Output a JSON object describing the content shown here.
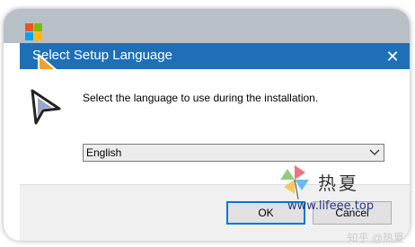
{
  "window": {
    "title": "Select Setup Language",
    "close_glyph": "✕",
    "message": "Select the language to use during the installation.",
    "language_select": {
      "selected": "English"
    },
    "buttons": {
      "ok": "OK",
      "cancel": "Cancel"
    }
  },
  "watermark": {
    "brand": "热夏",
    "site": "www.lifeee.top"
  },
  "credit": "知乎 @热夏",
  "colors": {
    "titlebar": "#1f6fb7",
    "ok_focus_border": "#0078d7",
    "logo_red": "#f25022",
    "logo_green": "#7fba00",
    "logo_blue": "#00a4ef",
    "logo_yellow": "#ffb900",
    "cursor_fill": "#f0a030"
  },
  "icons": {
    "logo": "windows-logo-icon",
    "cursor": "mouse-pointer-icon",
    "setup": "setup-wizard-icon",
    "dropdown": "chevron-down-icon",
    "close": "close-icon",
    "watermark": "pinwheel-icon"
  }
}
